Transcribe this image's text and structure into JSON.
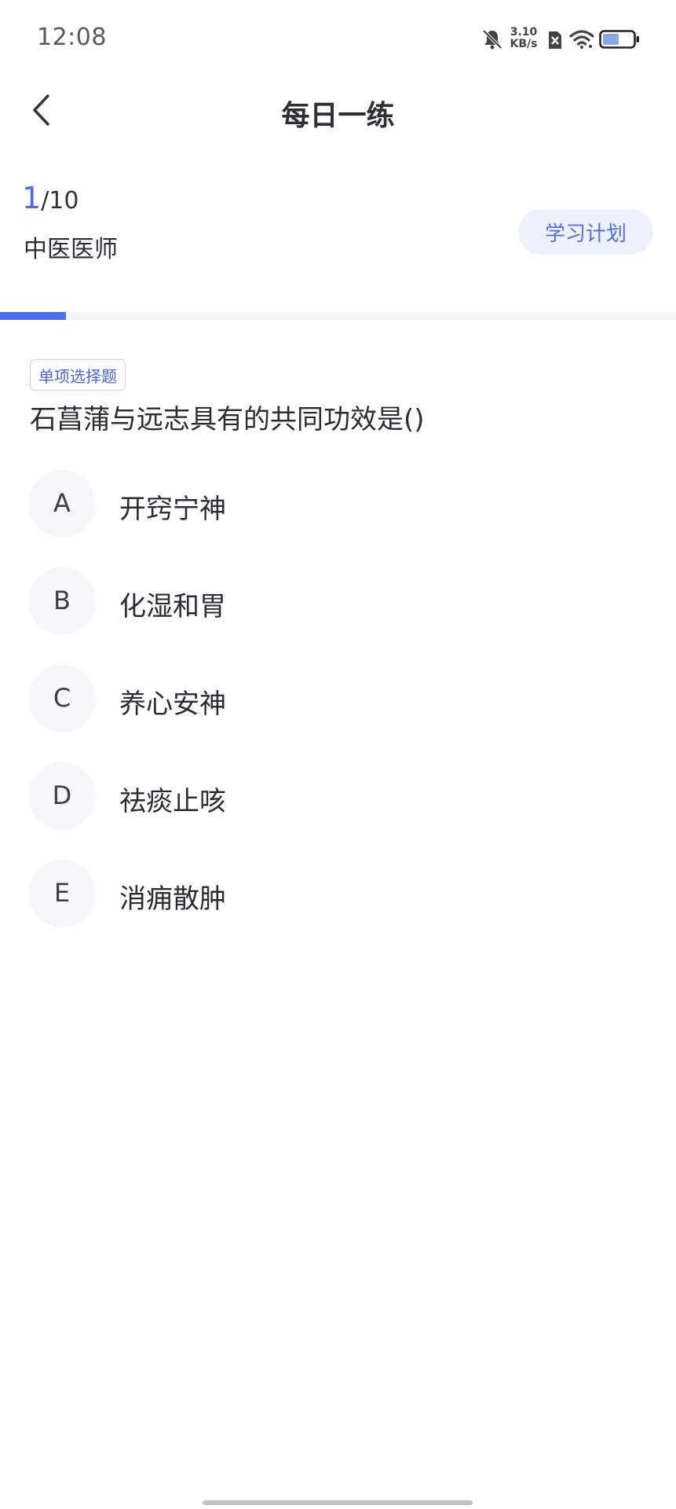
{
  "status_bar": {
    "time": "12:08",
    "net_speed_value": "3.10",
    "net_speed_unit": "KB/s",
    "icons": [
      "bell-muted-icon",
      "sim-blocked-icon",
      "wifi-icon",
      "battery-icon"
    ]
  },
  "header": {
    "title": "每日一练",
    "back_icon": "chevron-left-icon"
  },
  "progress": {
    "current": "1",
    "total": "/10",
    "fraction": 0.1
  },
  "subject": "中医医师",
  "plan_button_label": "学习计划",
  "question": {
    "type_label": "单项选择题",
    "stem": "石菖蒲与远志具有的共同功效是()",
    "options": [
      {
        "letter": "A",
        "text": "开窍宁神"
      },
      {
        "letter": "B",
        "text": "化湿和胃"
      },
      {
        "letter": "C",
        "text": "养心安神"
      },
      {
        "letter": "D",
        "text": "祛痰止咳"
      },
      {
        "letter": "E",
        "text": "消痈散肿"
      }
    ]
  },
  "colors": {
    "accent": "#4f6ef2",
    "plan_button_bg": "#edf1fd",
    "track": "#f3f4f8"
  }
}
